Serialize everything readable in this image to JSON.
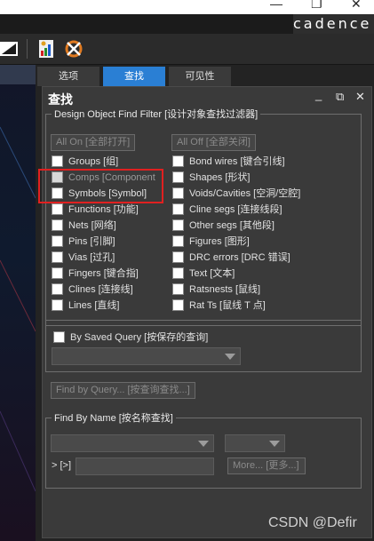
{
  "window": {
    "minimize": "—",
    "restore": "❐",
    "close": "✕",
    "brand": "cadence"
  },
  "toolbar": {
    "icons": [
      "layout-icon",
      "chart-icon",
      "swap-icon"
    ]
  },
  "tabs": [
    {
      "label": "选项",
      "active": false
    },
    {
      "label": "查找",
      "active": true
    },
    {
      "label": "可见性",
      "active": false
    }
  ],
  "panel": {
    "title": "查找",
    "pin": "_",
    "float": "⧉",
    "close": "✕"
  },
  "filter": {
    "legend": "Design Object Find Filter [设计对象查找过滤器]",
    "all_on": "All On [全部打开]",
    "all_off": "All Off [全部关闭]",
    "left_items": [
      {
        "label": "Groups [组]",
        "dim": false
      },
      {
        "label": "Comps [Component",
        "dim": true
      },
      {
        "label": "Symbols [Symbol]",
        "dim": false
      },
      {
        "label": "Functions [功能]",
        "dim": false
      },
      {
        "label": "Nets [网络]",
        "dim": false
      },
      {
        "label": "Pins [引脚]",
        "dim": false
      },
      {
        "label": "Vias [过孔]",
        "dim": false
      },
      {
        "label": "Fingers [键合指]",
        "dim": false
      },
      {
        "label": "Clines [连接线]",
        "dim": false
      },
      {
        "label": "Lines [直线]",
        "dim": false
      }
    ],
    "right_items": [
      {
        "label": "Bond wires [键合引线]"
      },
      {
        "label": "Shapes [形状]"
      },
      {
        "label": "Voids/Cavities [空洞/空腔]"
      },
      {
        "label": "Cline segs [连接线段]"
      },
      {
        "label": "Other segs [其他段]"
      },
      {
        "label": "Figures [图形]"
      },
      {
        "label": "DRC errors [DRC 错误]"
      },
      {
        "label": "Text [文本]"
      },
      {
        "label": "Ratsnests [鼠线]"
      },
      {
        "label": "Rat Ts [鼠线 T 点]"
      }
    ],
    "saved_query": "By Saved Query [按保存的查询]",
    "find_by_query": "Find by Query... [按查询查找...]"
  },
  "find_by_name": {
    "legend": "Find By Name [按名称查找]",
    "prefix": "> [>]",
    "more": "More... [更多...]"
  },
  "watermark": "CSDN @Defir"
}
